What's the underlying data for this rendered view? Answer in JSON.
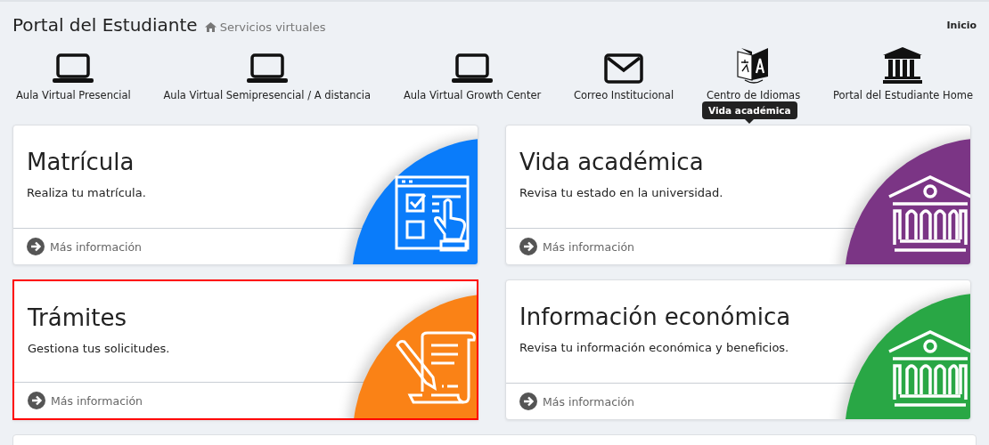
{
  "header": {
    "title": "Portal del Estudiante",
    "breadcrumb": "Servicios virtuales",
    "home_link": "Inicio"
  },
  "shortcuts": [
    {
      "label": "Aula Virtual Presencial",
      "kind": "laptop"
    },
    {
      "label": "Aula Virtual Semipresencial / A distancia",
      "kind": "laptop"
    },
    {
      "label": "Aula Virtual Growth Center",
      "kind": "laptop"
    },
    {
      "label": "Correo Institucional",
      "kind": "envelope"
    },
    {
      "label": "Centro de Idiomas",
      "kind": "translate"
    },
    {
      "label": "Portal del Estudiante Home",
      "kind": "building"
    }
  ],
  "tooltip": "Vida académica",
  "cards": [
    {
      "title": "Matrícula",
      "description": "Realiza tu matrícula.",
      "link": "Más información",
      "color": "#0a7cfa",
      "kind": "form",
      "selected": false
    },
    {
      "title": "Vida académica",
      "description": "Revisa tu estado en la universidad.",
      "link": "Más información",
      "color": "#7b3585",
      "kind": "building",
      "selected": false
    },
    {
      "title": "Trámites",
      "description": "Gestiona tus solicitudes.",
      "link": "Más información",
      "color": "#fa8216",
      "kind": "scroll",
      "selected": true
    },
    {
      "title": "Información económica",
      "description": "Revisa tu información económica y beneficios.",
      "link": "Más información",
      "color": "#29a745",
      "kind": "building",
      "selected": false
    }
  ]
}
